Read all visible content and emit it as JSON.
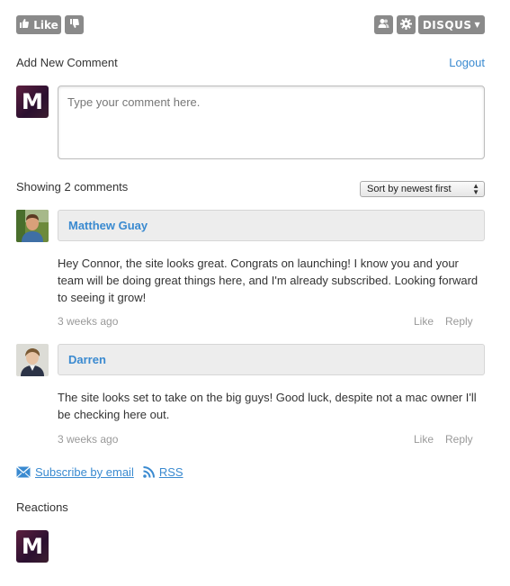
{
  "toolbar": {
    "like_label": "Like",
    "brand_label": "DISQUS"
  },
  "compose": {
    "title": "Add New Comment",
    "logout_label": "Logout",
    "avatar_letter": "M",
    "placeholder": "Type your comment here."
  },
  "comments_header": {
    "count_text": "Showing 2 comments",
    "sort_selected": "Sort by newest first"
  },
  "comments": [
    {
      "author": "Matthew Guay",
      "text": "Hey Connor, the site looks great. Congrats on launching! I know you and your team will be doing great things here, and I'm already subscribed. Looking forward to seeing it grow!",
      "time": "3 weeks ago",
      "like_label": "Like",
      "reply_label": "Reply"
    },
    {
      "author": "Darren",
      "text": "The site looks set to take on the big guys! Good luck, despite not a mac owner I'll be checking here out.",
      "time": "3 weeks ago",
      "like_label": "Like",
      "reply_label": "Reply"
    }
  ],
  "footer_links": {
    "subscribe_label": "Subscribe by email",
    "rss_label": "RSS"
  },
  "reactions": {
    "title": "Reactions",
    "avatar_letter": "M"
  },
  "colors": {
    "link": "#3a8ad0",
    "toolbar_button": "#8a8a8a",
    "author_bar": "#ededed"
  }
}
